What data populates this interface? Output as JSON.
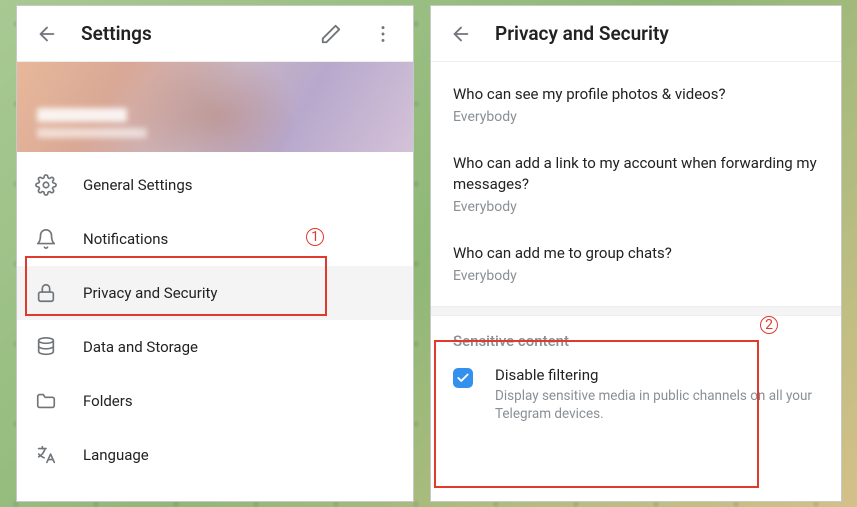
{
  "left": {
    "title": "Settings",
    "menu": [
      {
        "key": "general",
        "label": "General Settings"
      },
      {
        "key": "notif",
        "label": "Notifications"
      },
      {
        "key": "privacy",
        "label": "Privacy and Security",
        "active": true
      },
      {
        "key": "data",
        "label": "Data and Storage"
      },
      {
        "key": "folders",
        "label": "Folders"
      },
      {
        "key": "lang",
        "label": "Language"
      }
    ]
  },
  "right": {
    "title": "Privacy and Security",
    "privacy": [
      {
        "q": "Who can see my profile photos & videos?",
        "v": "Everybody"
      },
      {
        "q": "Who can add a link to my account when forwarding my messages?",
        "v": "Everybody"
      },
      {
        "q": "Who can add me to group chats?",
        "v": "Everybody"
      }
    ],
    "sensitive": {
      "section_label": "Sensitive content",
      "disable_filtering_label": "Disable filtering",
      "disable_filtering_sub": "Display sensitive media in public channels on all your Telegram devices.",
      "checked": true
    }
  },
  "annotations": {
    "one": "1",
    "two": "2"
  }
}
